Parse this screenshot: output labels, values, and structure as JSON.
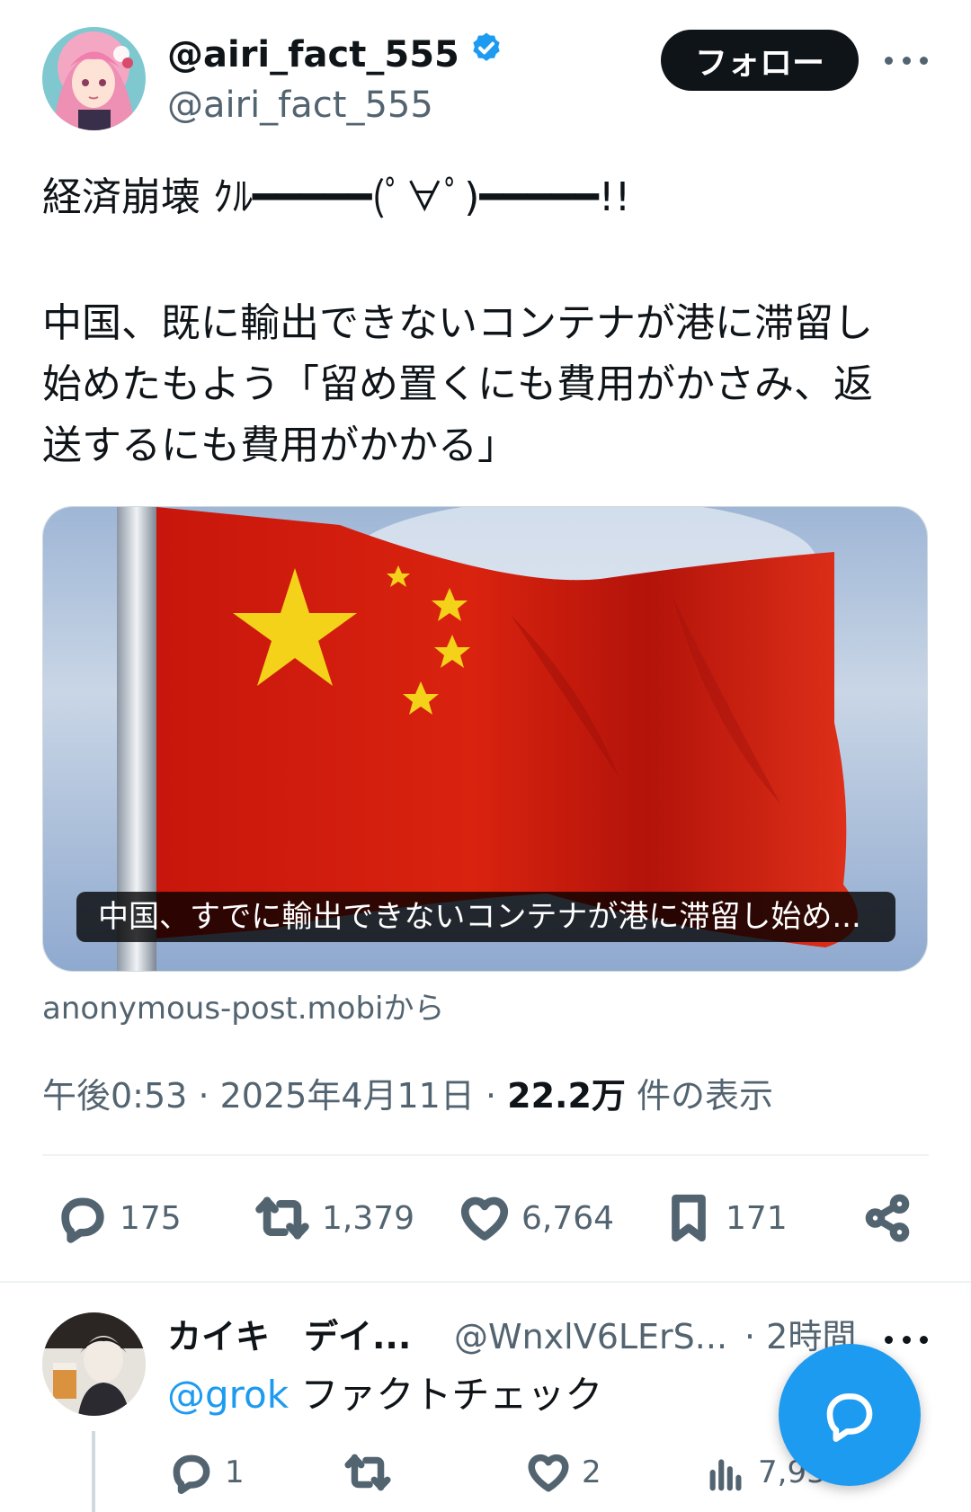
{
  "tweet": {
    "author": {
      "display_name": "@airi_fact_555",
      "handle": "@airi_fact_555",
      "verified": true,
      "avatar": "anime-girl-avatar"
    },
    "follow_label": "フォロー",
    "text_line1": "経済崩壊 ｸﾙ━━━━━(ﾟ∀ﾟ)━━━━━!!",
    "text_line2": "中国、既に輸出できないコンテナが港に滞留し",
    "text_line3": "始めたもよう「留め置くにも費用がかさみ、返",
    "text_line4": "送するにも費用がかかる」",
    "card": {
      "caption": "中国、すでに輸出できないコンテナが港に滞留し始め...",
      "source": "anonymous-post.mobiから",
      "image": "china-flag-image"
    },
    "time": "午後0:53",
    "date": "2025年4月11日",
    "views_count": "22.2万",
    "views_label": "件の表示",
    "stats": {
      "replies": "175",
      "retweets": "1,379",
      "likes": "6,764",
      "bookmarks": "171"
    }
  },
  "reply": {
    "display_name": "カイキ　デイ...",
    "handle": "@WnxlV6LErS...",
    "time": "· 2時間",
    "mention": "@grok",
    "text": " ファクトチェック",
    "stats": {
      "replies": "1",
      "retweets": "",
      "likes": "2",
      "views": "7,932"
    }
  },
  "colors": {
    "accent": "#1d9bf0",
    "text": "#0f1419",
    "secondary": "#536471",
    "flag_red": "#de2910",
    "flag_star": "#ffde00"
  }
}
